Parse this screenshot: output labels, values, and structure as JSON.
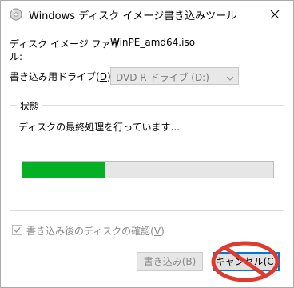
{
  "window": {
    "title": "Windows ディスク イメージ書き込みツール",
    "icon": "disc-burn-icon"
  },
  "image_file": {
    "label_line1": "ディスク イメージ ファイ",
    "label_line2": "ル:",
    "value": "WinPE_amd64.iso"
  },
  "drive": {
    "label": "書き込み用ドライブ(D):",
    "selected": "DVD R ドライブ (D:)"
  },
  "status_group": {
    "title": "状態",
    "message": "ディスクの最終処理を行っています...",
    "progress_fraction": 0.33
  },
  "verify": {
    "label": "書き込み後のディスクの確認(V)",
    "checked": true,
    "enabled": false
  },
  "buttons": {
    "write_label": "書き込み(B)",
    "cancel_label": "キャンセル(C)"
  },
  "annotation": {
    "icon": "prohibited-sign-icon",
    "color": "#e03a2f"
  },
  "colors": {
    "progress": "#06b025",
    "focus": "#0078d7"
  }
}
